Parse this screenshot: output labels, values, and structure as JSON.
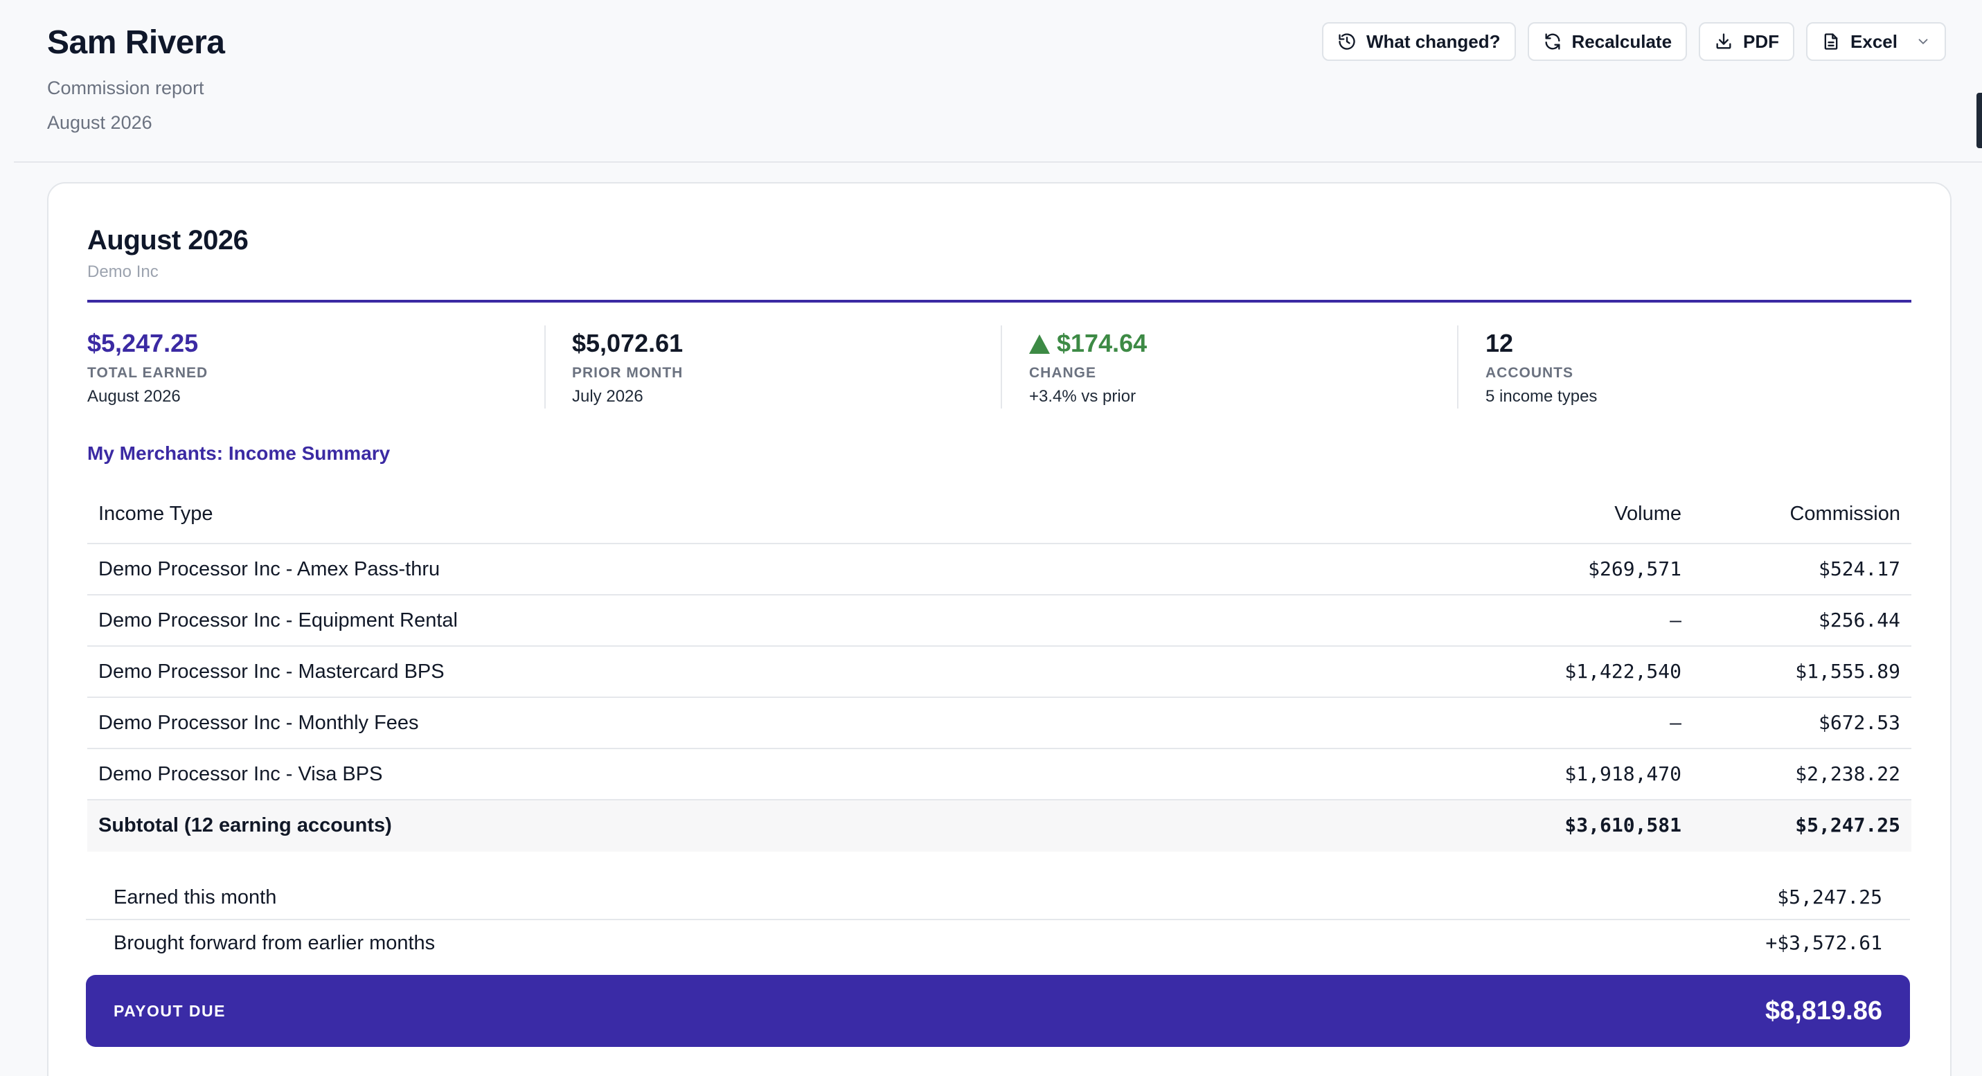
{
  "header": {
    "name": "Sam Rivera",
    "subtitle": "Commission report",
    "period": "August 2026"
  },
  "toolbar": {
    "what_changed": {
      "label": "What changed?",
      "icon": "history-icon"
    },
    "recalculate": {
      "label": "Recalculate",
      "icon": "refresh-icon"
    },
    "pdf": {
      "label": "PDF",
      "icon": "download-icon"
    },
    "excel": {
      "label": "Excel",
      "icon": "spreadsheet-icon"
    }
  },
  "card": {
    "title": "August 2026",
    "org": "Demo Inc",
    "accent_color": "#3b2aa3",
    "positive_color": "#3d8a45"
  },
  "stats": {
    "total": {
      "value": "$5,247.25",
      "label": "TOTAL EARNED",
      "sub": "August 2026"
    },
    "prior": {
      "value": "$5,072.61",
      "label": "PRIOR MONTH",
      "sub": "July 2026"
    },
    "change": {
      "value": "$174.64",
      "label": "CHANGE",
      "sub": "+3.4% vs prior",
      "direction": "up"
    },
    "accounts": {
      "value": "12",
      "label": "ACCOUNTS",
      "sub": "5 income types"
    }
  },
  "section_title": "My Merchants: Income Summary",
  "table": {
    "headers": {
      "type": "Income Type",
      "volume": "Volume",
      "commission": "Commission"
    },
    "rows": [
      {
        "type": "Demo Processor Inc - Amex Pass-thru",
        "volume": "$269,571",
        "commission": "$524.17"
      },
      {
        "type": "Demo Processor Inc - Equipment Rental",
        "volume": "—",
        "commission": "$256.44"
      },
      {
        "type": "Demo Processor Inc - Mastercard BPS",
        "volume": "$1,422,540",
        "commission": "$1,555.89"
      },
      {
        "type": "Demo Processor Inc - Monthly Fees",
        "volume": "—",
        "commission": "$672.53"
      },
      {
        "type": "Demo Processor Inc - Visa BPS",
        "volume": "$1,918,470",
        "commission": "$2,238.22"
      }
    ],
    "subtotal": {
      "type": "Subtotal (12 earning accounts)",
      "volume": "$3,610,581",
      "commission": "$5,247.25"
    }
  },
  "summary": {
    "earned": {
      "label": "Earned this month",
      "value": "$5,247.25"
    },
    "brought_forward": {
      "label": "Brought forward from earlier months",
      "value": "+$3,572.61"
    }
  },
  "payout": {
    "label": "PAYOUT DUE",
    "value": "$8,819.86"
  }
}
